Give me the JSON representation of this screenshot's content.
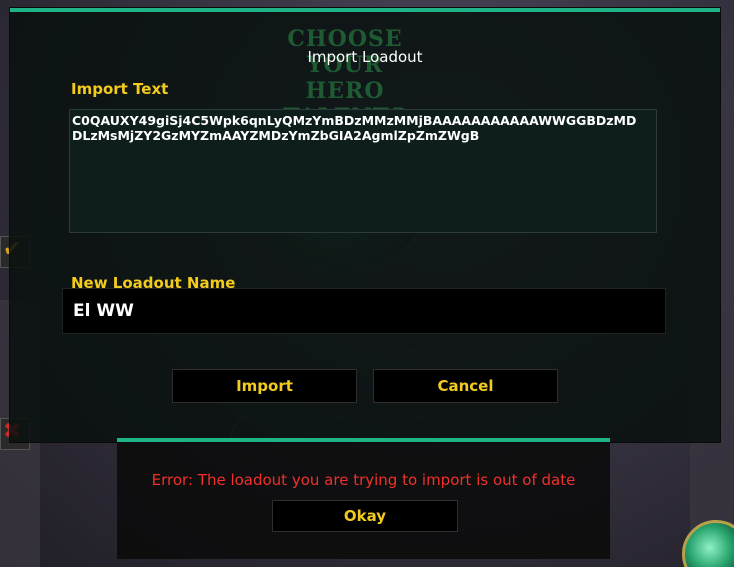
{
  "background": {
    "ghost_title_line1": "CHOOSE YOUR",
    "ghost_title_line2": "HERO TALENTS"
  },
  "dialog": {
    "title": "Import Loadout",
    "import_text_label": "Import Text",
    "import_text_value_line1": "C0QAUXY49giSj4C5Wpk6qnLyQMzYmBDzMMzMMjBAAAAAAAAAAAWWGGBDzMD",
    "import_text_value_line2": "DLzMsMjZY2GzMYZmAAYZMDzYmZbGIA2AgmlZpZmZWgB",
    "loadout_name_label": "New Loadout Name",
    "loadout_name_value": "El WW",
    "import_button": "Import",
    "cancel_button": "Cancel"
  },
  "error_popup": {
    "message": "Error: The loadout you are trying to import is out of date",
    "okay_button": "Okay"
  },
  "colors": {
    "accent": "#1fb487",
    "label_gold": "#f2cb1d",
    "error_red": "#f0302a"
  }
}
